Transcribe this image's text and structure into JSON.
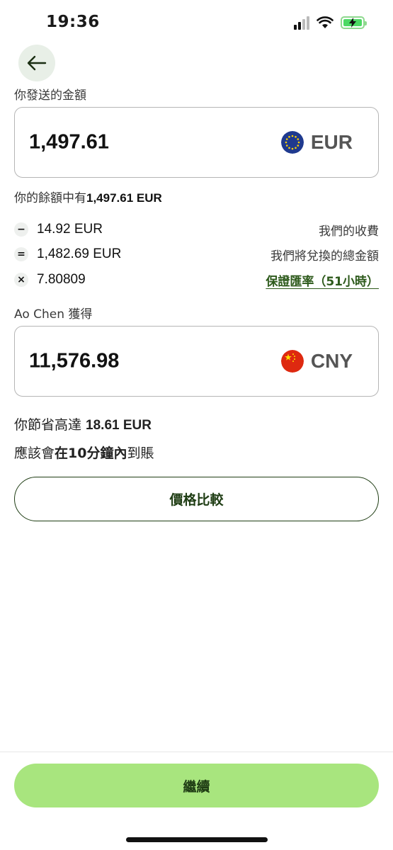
{
  "status_bar": {
    "time": "19:36"
  },
  "send": {
    "label": "你發送的金額",
    "amount": "1,497.61",
    "currency": "EUR",
    "balance_prefix": "你的餘額中有",
    "balance_value": "1,497.61 EUR"
  },
  "fees": [
    {
      "op": "−",
      "value": "14.92 EUR",
      "desc": "我們的收費",
      "op_icon": "minus-icon"
    },
    {
      "op": "=",
      "value": "1,482.69 EUR",
      "desc": "我們將兌換的總金額",
      "op_icon": "equals-icon"
    },
    {
      "op": "×",
      "value": "7.80809",
      "desc": "保證匯率（51小時）",
      "op_icon": "multiply-icon"
    }
  ],
  "receive": {
    "label": "Ao Chen 獲得",
    "amount": "11,576.98",
    "currency": "CNY"
  },
  "savings": {
    "prefix": "你節省高達 ",
    "value": "18.61 EUR"
  },
  "arrival": {
    "prefix": "應該會",
    "emphasis": "在10分鐘內",
    "suffix": "到賬"
  },
  "buttons": {
    "compare": "價格比較",
    "continue": "繼續"
  },
  "colors": {
    "accent": "#a8e57e",
    "dark_green": "#1f3d14",
    "link_green": "#2d5a1b"
  }
}
